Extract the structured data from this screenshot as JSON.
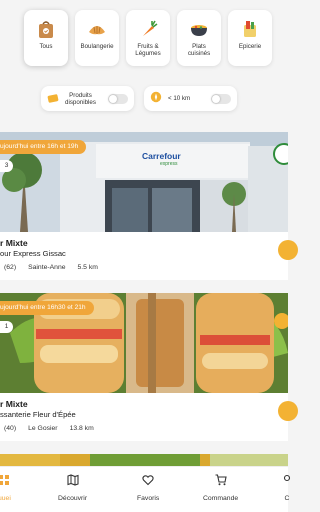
{
  "categories": [
    {
      "label": "Tous",
      "icon": "bag-icon",
      "active": true
    },
    {
      "label": "Boulangerie",
      "icon": "croissant-icon",
      "active": false
    },
    {
      "label": "Fruits &\nLégumes",
      "icon": "carrot-icon",
      "active": false
    },
    {
      "label": "Plats\ncuisinés",
      "icon": "pot-icon",
      "active": false
    },
    {
      "label": "Epicerie",
      "icon": "grocery-icon",
      "active": false
    }
  ],
  "filters": {
    "available_label": "Produits\ndisponibles",
    "distance_label": "< 10 km"
  },
  "cards": [
    {
      "time": "ujourd'hui entre 16h et 19h",
      "count": "3",
      "title": "r Mixte",
      "store": "our Express Gissac",
      "rating_count": "(62)",
      "location": "Sainte-Anne",
      "distance": "5.5 km",
      "storefront_sign": "Carrefour",
      "storefront_sub": "express"
    },
    {
      "time": "ujourd'hui entre 16h30 et 21h",
      "count": "1",
      "title": "r Mixte",
      "store": "ssanterie Fleur d'Épée",
      "rating_count": "(40)",
      "location": "Le Gosier",
      "distance": "13.8 km"
    }
  ],
  "nav": [
    {
      "label": "uuei",
      "icon": "home-icon",
      "active": true
    },
    {
      "label": "Découvrir",
      "icon": "map-icon",
      "active": false
    },
    {
      "label": "Favoris",
      "icon": "heart-icon",
      "active": false
    },
    {
      "label": "Commande",
      "icon": "cart-icon",
      "active": false
    },
    {
      "label": "C",
      "icon": "profile-icon",
      "active": false
    }
  ],
  "colors": {
    "accent": "#f0a63a",
    "background": "#f4f4f4"
  }
}
